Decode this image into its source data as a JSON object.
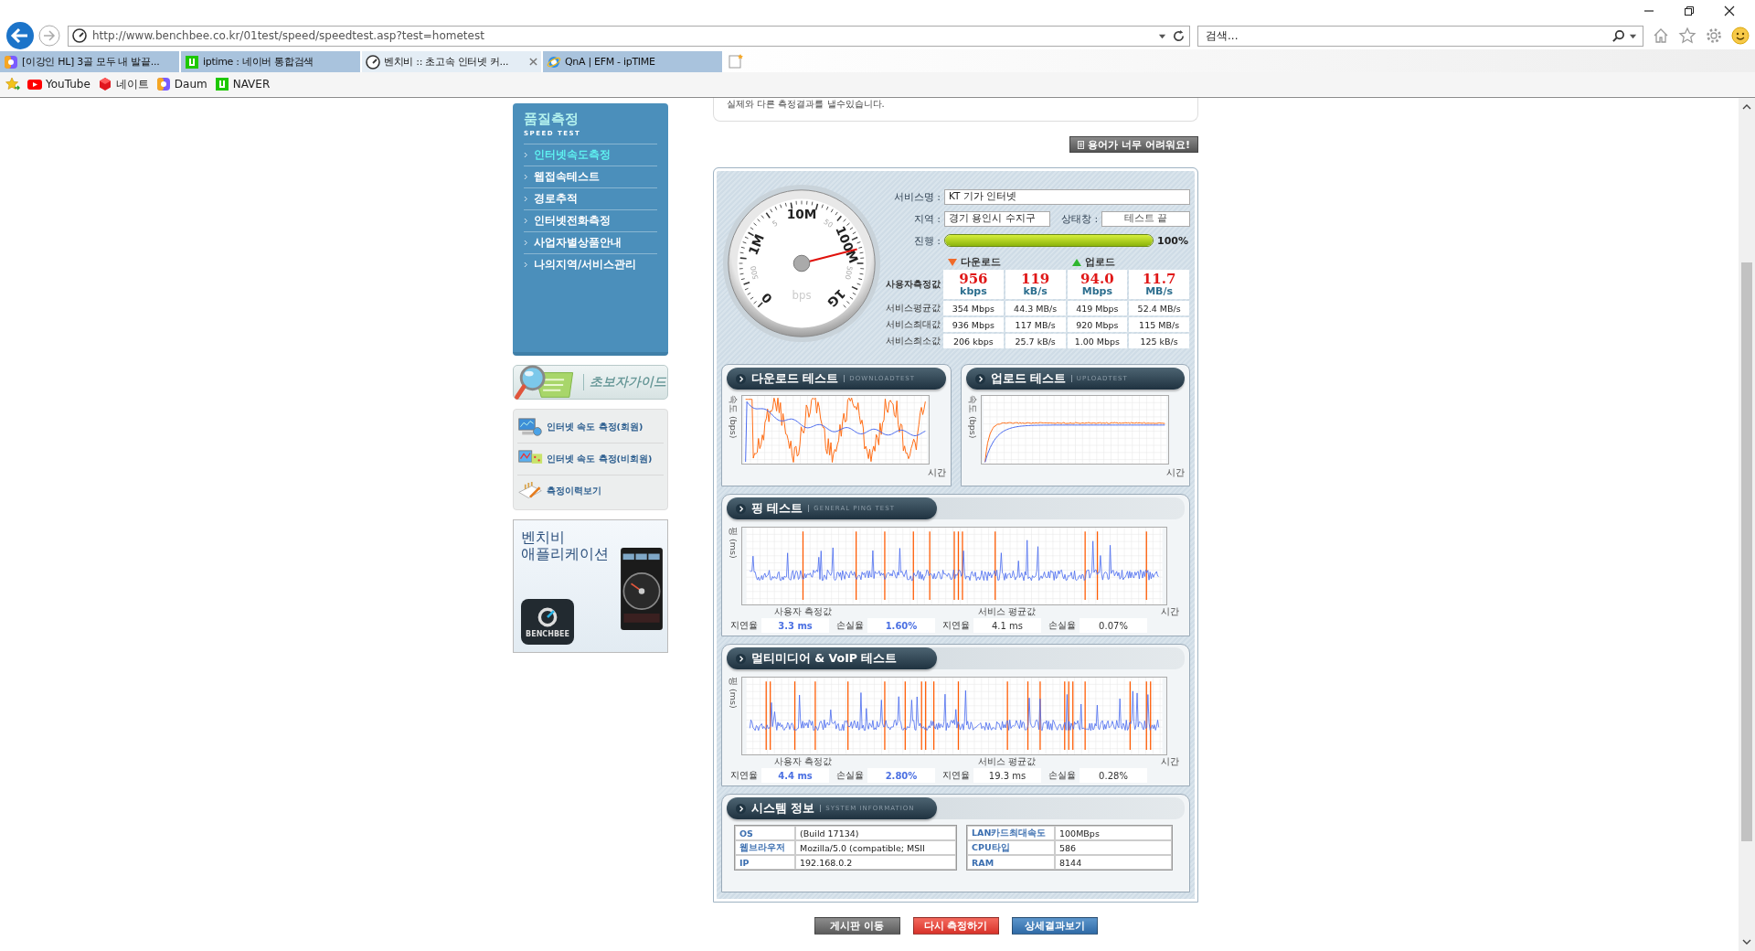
{
  "browser": {
    "address": "http://www.benchbee.co.kr/01test/speed/speedtest.asp?test=hometest",
    "search_placeholder": "검색...",
    "tabs": [
      {
        "label": "[이강인 HL] 3골 모두 내 발끝...",
        "kind": "daum",
        "selected": false
      },
      {
        "label": "iptime : 네이버 통합검색",
        "kind": "naver",
        "selected": false
      },
      {
        "label": "벤치비 :: 초고속 인터넷 커...",
        "kind": "gauge",
        "selected": true
      },
      {
        "label": "QnA | EFM - ipTIME",
        "kind": "ie",
        "selected": false
      }
    ],
    "favorites": [
      {
        "label": "YouTube",
        "kind": "youtube"
      },
      {
        "label": "네이트",
        "kind": "nate"
      },
      {
        "label": "Daum",
        "kind": "daum"
      },
      {
        "label": "NAVER",
        "kind": "naver"
      }
    ]
  },
  "sidebar": {
    "title": "품질측정",
    "subtitle": "SPEED TEST",
    "items": [
      {
        "label": "인터넷속도측정",
        "selected": true
      },
      {
        "label": "웹접속테스트",
        "selected": false
      },
      {
        "label": "경로추적",
        "selected": false
      },
      {
        "label": "인터넷전화측정",
        "selected": false
      },
      {
        "label": "사업자별상품안내",
        "selected": false
      },
      {
        "label": "나의지역/서비스관리",
        "selected": false
      }
    ]
  },
  "guide": {
    "title": "초보자가이드",
    "items": [
      {
        "label": "인터넷 속도 측정(회원)",
        "kind": "monitor"
      },
      {
        "label": "인터넷 속도 측정(비회원)",
        "kind": "chart"
      },
      {
        "label": "측정이력보기",
        "kind": "notepad"
      }
    ]
  },
  "app_banner": {
    "title": "벤치비 애플리케이션",
    "logo_text": "BENCHBEE"
  },
  "notice": "실제와 다른 측정결과를 낼수있습니다.",
  "help_button": "용어가 너무 어려워요!",
  "gauge": {
    "unit": "bps",
    "labels": [
      {
        "text": "0",
        "kind": "major"
      },
      {
        "text": "500",
        "kind": "minor"
      },
      {
        "text": "1M",
        "kind": "major"
      },
      {
        "text": "5",
        "kind": "minor"
      },
      {
        "text": "10M",
        "kind": "major"
      },
      {
        "text": "50",
        "kind": "minor"
      },
      {
        "text": "100M",
        "kind": "major"
      },
      {
        "text": "500",
        "kind": "minor"
      },
      {
        "text": "1G",
        "kind": "major"
      }
    ]
  },
  "info": {
    "service_label": "서비스명 :",
    "service": "KT 기가 인터넷",
    "region_label": "지역 :",
    "region": "경기 용인시 수지구",
    "status_label": "상태창 :",
    "status": "테스트 끝",
    "progress_label": "진행 :",
    "progress": {
      "level": 1,
      "reading": "100%"
    }
  },
  "speed_table": {
    "download": "다운로드",
    "upload": "업로드",
    "rows": [
      {
        "label": "사용자측정값",
        "kind": "user",
        "cells": [
          {
            "value": "956",
            "unit": "kbps"
          },
          {
            "value": "119",
            "unit": "kB/s"
          },
          {
            "value": "94.0",
            "unit": "Mbps"
          },
          {
            "value": "11.7",
            "unit": "MB/s"
          }
        ]
      },
      {
        "label": "서비스평균값",
        "kind": "service",
        "cells": [
          {
            "value": "354 Mbps"
          },
          {
            "value": "44.3 MB/s"
          },
          {
            "value": "419 Mbps"
          },
          {
            "value": "52.4 MB/s"
          }
        ]
      },
      {
        "label": "서비스최대값",
        "kind": "service",
        "cells": [
          {
            "value": "936 Mbps"
          },
          {
            "value": "117 MB/s"
          },
          {
            "value": "920 Mbps"
          },
          {
            "value": "115 MB/s"
          }
        ]
      },
      {
        "label": "서비스최소값",
        "kind": "service",
        "cells": [
          {
            "value": "206 kbps"
          },
          {
            "value": "25.7 kB/s"
          },
          {
            "value": "1.00 Mbps"
          },
          {
            "value": "125 kB/s"
          }
        ]
      }
    ]
  },
  "download_test": {
    "title": "다운로드 테스트",
    "subtitle": "DOWNLOADTEST",
    "y_label": "속도 (bps)",
    "x_label": "시간"
  },
  "upload_test": {
    "title": "업로드 테스트",
    "subtitle": "UPLOADTEST",
    "y_label": "속도 (bps)",
    "x_label": "시간"
  },
  "ping_test": {
    "title": "핑 테스트",
    "subtitle": "GENERAL PING TEST",
    "y_label": "핑 (ms)",
    "x_label": "시간",
    "user_label": "사용자 측정값",
    "service_label": "서비스 평균값",
    "stats": [
      {
        "label": "지연율",
        "value": "3.3 ms",
        "kind": "user"
      },
      {
        "label": "손실율",
        "value": "1.60%",
        "kind": "user"
      },
      {
        "label": "지연율",
        "value": "4.1 ms",
        "kind": "service"
      },
      {
        "label": "손실율",
        "value": "0.07%",
        "kind": "service"
      }
    ]
  },
  "voip_test": {
    "title": "멀티미디어 & VoIP 테스트",
    "y_label": "핑 (ms)",
    "x_label": "시간",
    "user_label": "사용자 측정값",
    "service_label": "서비스 평균값",
    "stats": [
      {
        "label": "지연율",
        "value": "4.4 ms",
        "kind": "user"
      },
      {
        "label": "손실율",
        "value": "2.80%",
        "kind": "user"
      },
      {
        "label": "지연율",
        "value": "19.3 ms",
        "kind": "service"
      },
      {
        "label": "손실율",
        "value": "0.28%",
        "kind": "service"
      }
    ]
  },
  "system_info": {
    "title": "시스템 정보",
    "subtitle": "SYSTEM INFORMATION",
    "left": [
      {
        "label": "OS",
        "value": "(Build 17134)"
      },
      {
        "label": "웹브라우저",
        "value": "Mozilla/5.0 (compatible; MSII"
      },
      {
        "label": "IP",
        "value": "192.168.0.2"
      }
    ],
    "right": [
      {
        "label": "LAN카드최대속도",
        "value": "100MBps"
      },
      {
        "label": "CPU타입",
        "value": "586"
      },
      {
        "label": "RAM",
        "value": "8144"
      }
    ]
  },
  "bottom_buttons": [
    {
      "label": "게시판 이동",
      "kind": "gray"
    },
    {
      "label": "다시 측정하기",
      "kind": "red"
    },
    {
      "label": "상세결과보기",
      "kind": "blue"
    }
  ]
}
